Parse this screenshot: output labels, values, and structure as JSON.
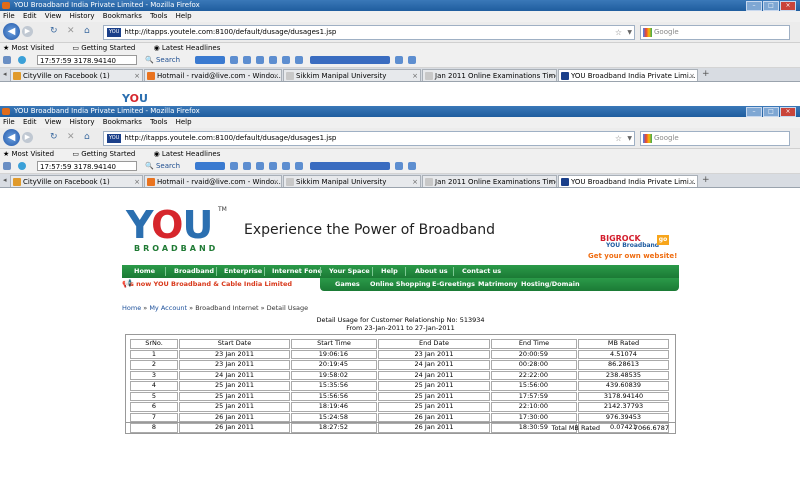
{
  "window": {
    "title": "YOU Broadband India Private Limited - Mozilla Firefox",
    "controls": [
      "–",
      "□",
      "×"
    ]
  },
  "menu": [
    "File",
    "Edit",
    "View",
    "History",
    "Bookmarks",
    "Tools",
    "Help"
  ],
  "nav": {
    "url": "http://itapps.youtele.com:8100/default/dusage/dusages1.jsp",
    "favicon_text": "YOU",
    "search_placeholder": "Google"
  },
  "bookmarks": [
    "Most Visited",
    "Getting Started",
    "Latest Headlines"
  ],
  "toolbar": {
    "ticker": "17:57:59  3178.94140",
    "search_label": "Search"
  },
  "tabs": [
    {
      "label": "CityVille on Facebook (1)",
      "icon_color": "#e09a2b"
    },
    {
      "label": "Hotmail - rvaid@live.com - Windo...",
      "icon_color": "#e9731f"
    },
    {
      "label": "Sikkim Manipal University",
      "icon_color": "#c8c8c8"
    },
    {
      "label": "Jan 2011 Online Examinations Timet...",
      "icon_color": "#c8c8c8"
    },
    {
      "label": "YOU Broadband India Private Limi...",
      "icon_color": "#1a3f8a",
      "active": true
    }
  ],
  "site": {
    "logo_you": "YOU",
    "logo_tm": "TM",
    "logo_sub": "BROADBAND",
    "tagline": "Experience the Power of Broadband",
    "bigrock": "BIGROCK",
    "bigrock_sub": "YOU Broadband",
    "bigrock_go": "go",
    "bigrock_cta": "Get your own website!",
    "main_nav": [
      "Home",
      "Broadband",
      "Enterprise",
      "Internet Fone",
      "Your Space",
      "Help",
      "About us",
      "Contact us"
    ],
    "marquee": "s now YOU Broadband & Cable India Limited",
    "sub_nav": [
      "Games",
      "Online Shopping",
      "E-Greetings",
      "Matrimony",
      "Hosting/Domain"
    ],
    "breadcrumb": {
      "home": "Home",
      "sep": " » ",
      "account": "My Account",
      "section": "Broadband Internet",
      "current": "Detail Usage"
    }
  },
  "report": {
    "title": "Detail Usage for Customer Relationship No: 513934",
    "range": "From 23-Jan-2011 to 27-Jan-2011",
    "columns": [
      "SrNo.",
      "Start Date",
      "Start Time",
      "End Date",
      "End Time",
      "MB Rated"
    ],
    "rows": [
      [
        "1",
        "23 Jan 2011",
        "19:06:16",
        "23 Jan 2011",
        "20:00:59",
        "4.51074"
      ],
      [
        "2",
        "23 Jan 2011",
        "20:19:45",
        "24 Jan 2011",
        "00:28:00",
        "86.28613"
      ],
      [
        "3",
        "24 Jan 2011",
        "19:58:02",
        "24 Jan 2011",
        "22:22:00",
        "238.48535"
      ],
      [
        "4",
        "25 Jan 2011",
        "15:35:56",
        "25 Jan 2011",
        "15:56:00",
        "439.60839"
      ],
      [
        "5",
        "25 Jan 2011",
        "15:56:56",
        "25 Jan 2011",
        "17:57:59",
        "3178.94140"
      ],
      [
        "6",
        "25 Jan 2011",
        "18:19:46",
        "25 Jan 2011",
        "22:10:00",
        "2142.37793"
      ],
      [
        "7",
        "26 Jan 2011",
        "15:24:58",
        "26 Jan 2011",
        "17:30:00",
        "976.39453"
      ],
      [
        "8",
        "26 Jan 2011",
        "18:27:52",
        "26 Jan 2011",
        "18:30:59",
        "0.07421"
      ]
    ],
    "total_label": "Total MB Rated",
    "total_value": "7066.6787"
  }
}
